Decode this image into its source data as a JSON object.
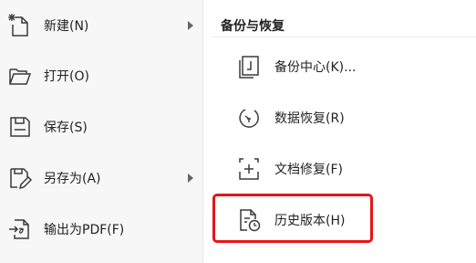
{
  "menu": {
    "items": [
      {
        "label": "新建(N)",
        "icon": "new-file-icon",
        "has_submenu": true
      },
      {
        "label": "打开(O)",
        "icon": "folder-icon",
        "has_submenu": false
      },
      {
        "label": "保存(S)",
        "icon": "save-icon",
        "has_submenu": false
      },
      {
        "label": "另存为(A)",
        "icon": "save-as-icon",
        "has_submenu": true
      },
      {
        "label": "输出为PDF(F)",
        "icon": "export-pdf-icon",
        "has_submenu": false
      }
    ]
  },
  "backup_panel": {
    "title": "备份与恢复",
    "items": [
      {
        "label": "备份中心(K)...",
        "icon": "backup-center-icon"
      },
      {
        "label": "数据恢复(R)",
        "icon": "data-recovery-icon"
      },
      {
        "label": "文档修复(F)",
        "icon": "document-repair-icon"
      },
      {
        "label": "历史版本(H)",
        "icon": "history-version-icon",
        "highlighted": true
      }
    ]
  },
  "colors": {
    "highlight_border": "#e8141a",
    "icon_stroke": "#3a3a3a",
    "left_pane_bg": "#f7f7f7"
  }
}
